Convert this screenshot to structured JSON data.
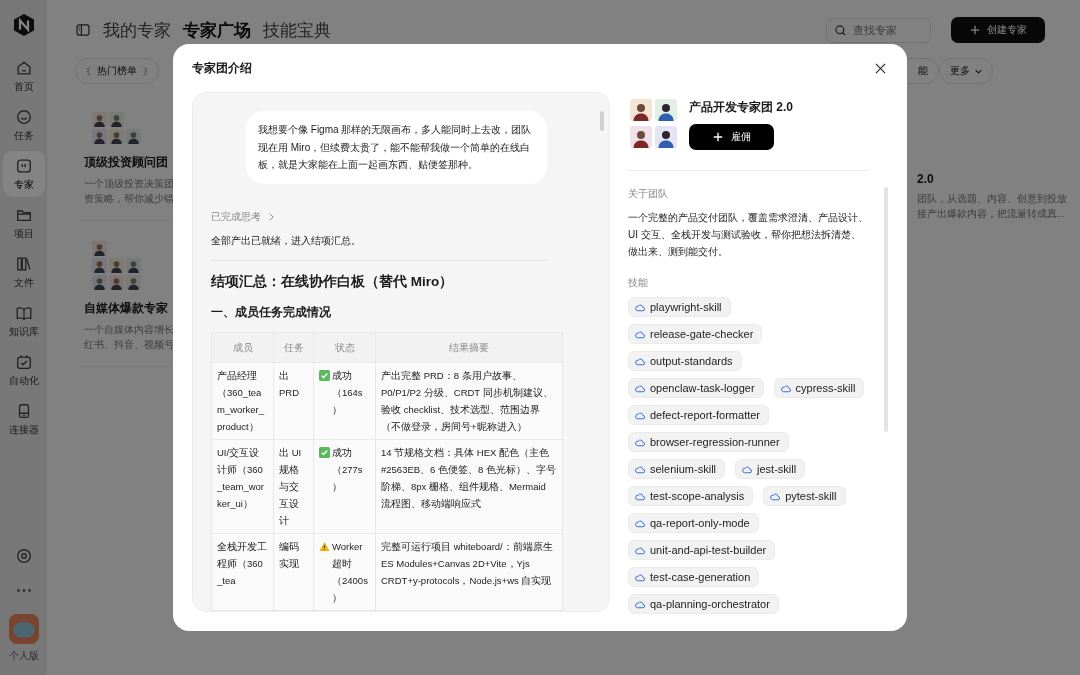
{
  "sidebar": {
    "items": [
      {
        "label": "首页",
        "selected": false
      },
      {
        "label": "任务",
        "selected": false
      },
      {
        "label": "专家",
        "selected": true
      },
      {
        "label": "项目",
        "selected": false
      },
      {
        "label": "文件",
        "selected": false
      },
      {
        "label": "知识库",
        "selected": false
      },
      {
        "label": "自动化",
        "selected": false
      },
      {
        "label": "连接器",
        "selected": false
      }
    ],
    "account_label": "个人版"
  },
  "header": {
    "tabs": [
      {
        "label": "我的专家",
        "selected": false
      },
      {
        "label": "专家广场",
        "selected": true
      },
      {
        "label": "技能宝典",
        "selected": false
      }
    ],
    "search": {
      "placeholder": "查找专家"
    },
    "create_button": "创建专家"
  },
  "filters": [
    {
      "label": "热门榜单",
      "kind": "ranking"
    },
    {
      "label": "能",
      "kind": "plain"
    },
    {
      "label": "更多",
      "kind": "dropdown"
    }
  ],
  "cards": [
    {
      "kind": "grid",
      "title": "顶级投资顾问团",
      "lines": [
        "一个顶级投资决策团",
        "资策略，帮你减少错"
      ]
    },
    {
      "kind": "pyramid",
      "title": "自媒体爆款专家",
      "lines": [
        "一个自媒体内容增长",
        "红书、抖音、视频号"
      ]
    },
    {
      "kind": "text",
      "title": "2.0",
      "lines": [
        "团队，从选题、内容、创意到投放",
        "接产出爆款内容，把流量转成真..."
      ]
    }
  ],
  "modal": {
    "title": "专家团介绍",
    "conversation": {
      "user_message": "我想要个像 Figma 那样的无限画布，多人能同时上去改，团队现在用 Miro，但续费太贵了，能不能帮我做一个简单的在线白板，就是大家能在上面一起画东西、贴便签那种。",
      "thinking_label": "已完成思考",
      "status_line": "全部产出已就绪，进入结项汇总。",
      "heading": "结项汇总：在线协作白板（替代 Miro）",
      "subheading": "一、成员任务完成情况",
      "table": {
        "columns": [
          "成员",
          "任务",
          "状态",
          "结果摘要"
        ],
        "rows": [
          {
            "member": "产品经理（360_team_worker_product）",
            "task": "出 PRD",
            "status": {
              "kind": "success",
              "text": "成功（164s）"
            },
            "summary": "产出完整 PRD：8 条用户故事、P0/P1/P2 分级、CRDT 同步机制建议、验收 checklist、技术选型、范围边界（不做登录，房间号+昵称进入）"
          },
          {
            "member": "UI/交互设计师（360_team_worker_ui）",
            "task": "出 UI 规格与交互设计",
            "status": {
              "kind": "success",
              "text": "成功（277s）"
            },
            "summary": "14 节规格文档：具体 HEX 配色（主色 #2563EB、6 色便签、8 色光标）、字号阶梯、8px 栅格、组件规格、Mermaid 流程图、移动端响应式"
          },
          {
            "member": "全栈开发工程师（360_tea",
            "task": "编码实现",
            "status": {
              "kind": "warning",
              "text": "Worker 超时（2400s）"
            },
            "summary": "完整可运行项目 whiteboard/：前端原生 ES Modules+Canvas 2D+Vite，Yjs CRDT+y-protocols，Node.js+ws 自实现"
          }
        ]
      }
    },
    "team": {
      "name": "产品开发专家团 2.0",
      "hire_button": "雇佣",
      "about_label": "关于团队",
      "about": "一个完整的产品交付团队，覆盖需求澄清、产品设计、UI 交互、全栈开发与测试验收，帮你把想法拆清楚、做出来、测到能交付。",
      "skills_label": "技能",
      "skills": [
        "playwright-skill",
        "release-gate-checker",
        "output-standards",
        "openclaw-task-logger",
        "cypress-skill",
        "defect-report-formatter",
        "browser-regression-runner",
        "selenium-skill",
        "jest-skill",
        "test-scope-analysis",
        "pytest-skill",
        "qa-report-only-mode",
        "unit-and-api-test-builder",
        "test-case-generation",
        "qa-planning-orchestrator"
      ]
    }
  }
}
